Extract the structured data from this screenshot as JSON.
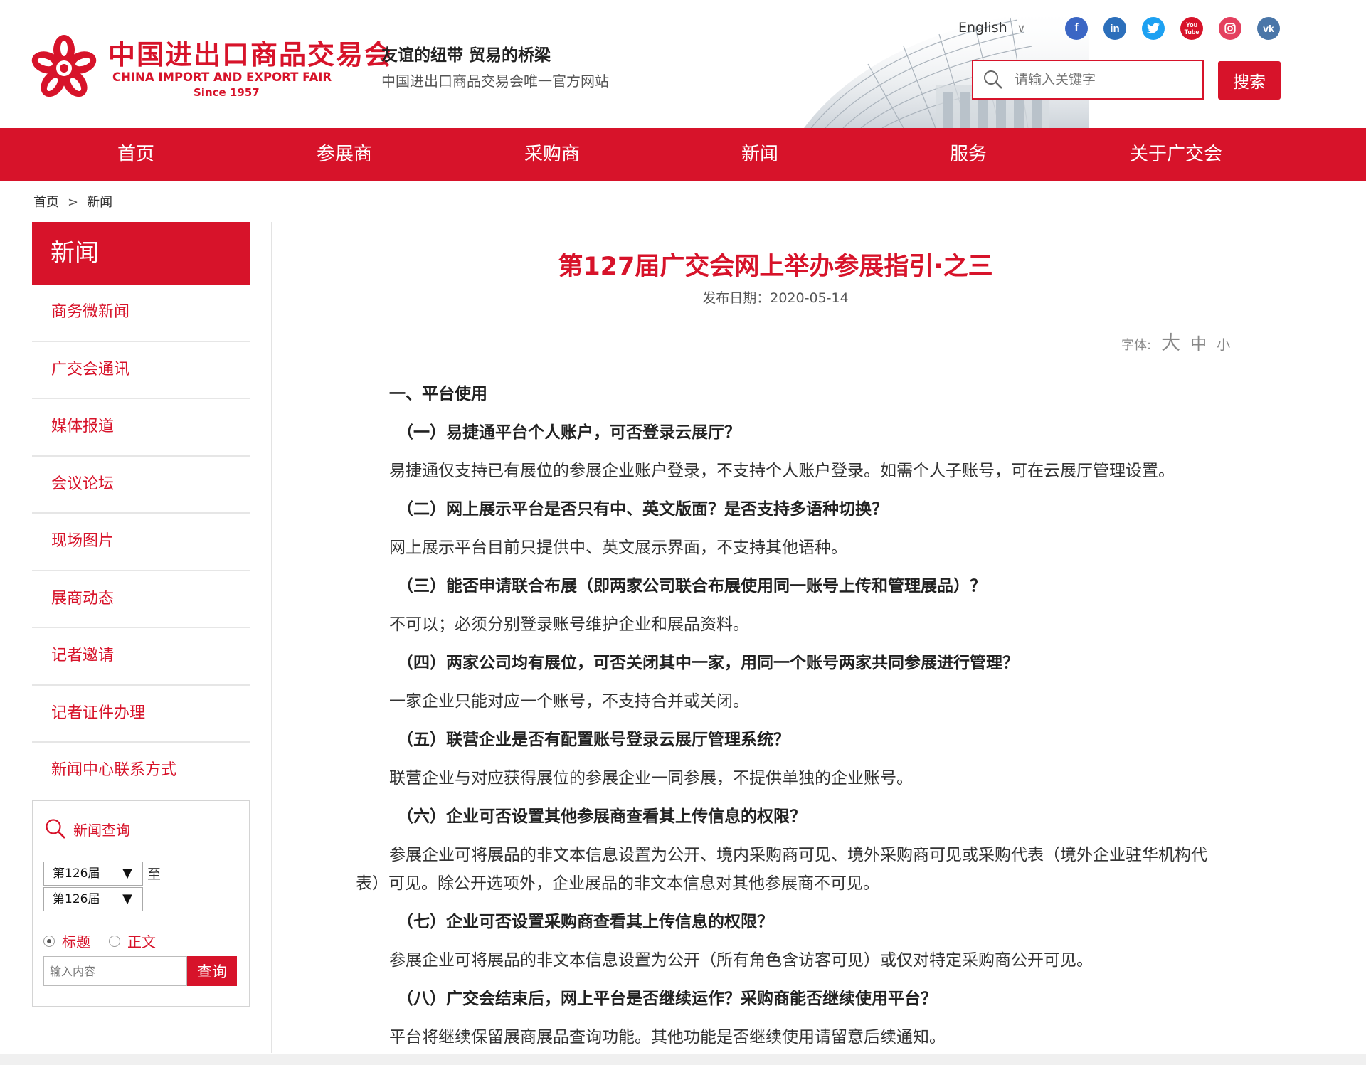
{
  "header": {
    "logo_cn": "中国进出口商品交易会",
    "logo_en": "CHINA IMPORT AND EXPORT FAIR",
    "logo_since": "Since 1957",
    "slogan": "友谊的纽带 贸易的桥梁",
    "subslogan": "中国进出口商品交易会唯一官方网站",
    "language": "English",
    "socials": [
      {
        "icon": "facebook-icon",
        "glyph": "f",
        "color": "#3b66c4"
      },
      {
        "icon": "linkedin-icon",
        "glyph": "in",
        "color": "#2c6fbb"
      },
      {
        "icon": "twitter-icon",
        "glyph": "t",
        "color": "#1da1f2"
      },
      {
        "icon": "youtube-icon",
        "glyph": "▶",
        "color": "#d7132a"
      },
      {
        "icon": "instagram-icon",
        "glyph": "◎",
        "color": "#e4405f"
      },
      {
        "icon": "vk-icon",
        "glyph": "vk",
        "color": "#4a76a8"
      }
    ],
    "search_placeholder": "请输入关键字",
    "search_button": "搜索"
  },
  "nav": [
    "首页",
    "参展商",
    "采购商",
    "新闻",
    "服务",
    "关于广交会"
  ],
  "breadcrumb": {
    "home": "首页",
    "sep": ">",
    "current": "新闻"
  },
  "sidebar": {
    "title": "新闻",
    "items": [
      "商务微新闻",
      "广交会通讯",
      "媒体报道",
      "会议论坛",
      "现场图片",
      "展商动态",
      "记者邀请",
      "记者证件办理",
      "新闻中心联系方式"
    ],
    "query": {
      "title": "新闻查询",
      "from": "第126届",
      "to_label": "至",
      "to": "第126届",
      "radio_title": "标题",
      "radio_body": "正文",
      "input_placeholder": "输入内容",
      "button": "查询"
    }
  },
  "article": {
    "title": "第127届广交会网上举办参展指引·之三",
    "date": "发布日期：2020-05-14",
    "font_label": "字体:",
    "font_big": "大",
    "font_mid": "中",
    "font_small": "小",
    "lines": [
      {
        "type": "h",
        "text": "一、平台使用"
      },
      {
        "type": "q",
        "text": "（一）易捷通平台个人账户，可否登录云展厅？"
      },
      {
        "type": "a",
        "text": "易捷通仅支持已有展位的参展企业账户登录，不支持个人账户登录。如需个人子账号，可在云展厅管理设置。"
      },
      {
        "type": "q",
        "text": "（二）网上展示平台是否只有中、英文版面？是否支持多语种切换？"
      },
      {
        "type": "a",
        "text": "网上展示平台目前只提供中、英文展示界面，不支持其他语种。"
      },
      {
        "type": "q",
        "text": "（三）能否申请联合布展（即两家公司联合布展使用同一账号上传和管理展品）？"
      },
      {
        "type": "a",
        "text": "不可以；必须分别登录账号维护企业和展品资料。"
      },
      {
        "type": "q",
        "text": "（四）两家公司均有展位，可否关闭其中一家，用同一个账号两家共同参展进行管理？"
      },
      {
        "type": "a",
        "text": "一家企业只能对应一个账号，不支持合并或关闭。"
      },
      {
        "type": "q",
        "text": "（五）联营企业是否有配置账号登录云展厅管理系统？"
      },
      {
        "type": "a",
        "text": "联营企业与对应获得展位的参展企业一同参展，不提供单独的企业账号。"
      },
      {
        "type": "q",
        "text": "（六）企业可否设置其他参展商查看其上传信息的权限？"
      },
      {
        "type": "a",
        "text": "参展企业可将展品的非文本信息设置为公开、境内采购商可见、境外采购商可见或采购代表（境外企业驻华机构代"
      },
      {
        "type": "w",
        "text": "表）可见。除公开选项外，企业展品的非文本信息对其他参展商不可见。"
      },
      {
        "type": "q",
        "text": "（七）企业可否设置采购商查看其上传信息的权限？"
      },
      {
        "type": "a",
        "text": "参展企业可将展品的非文本信息设置为公开（所有角色含访客可见）或仅对特定采购商公开可见。"
      },
      {
        "type": "q",
        "text": "（八）广交会结束后，网上平台是否继续运作？采购商能否继续使用平台？"
      },
      {
        "type": "a",
        "text": "平台将继续保留展商展品查询功能。其他功能是否继续使用请留意后续通知。"
      }
    ]
  }
}
